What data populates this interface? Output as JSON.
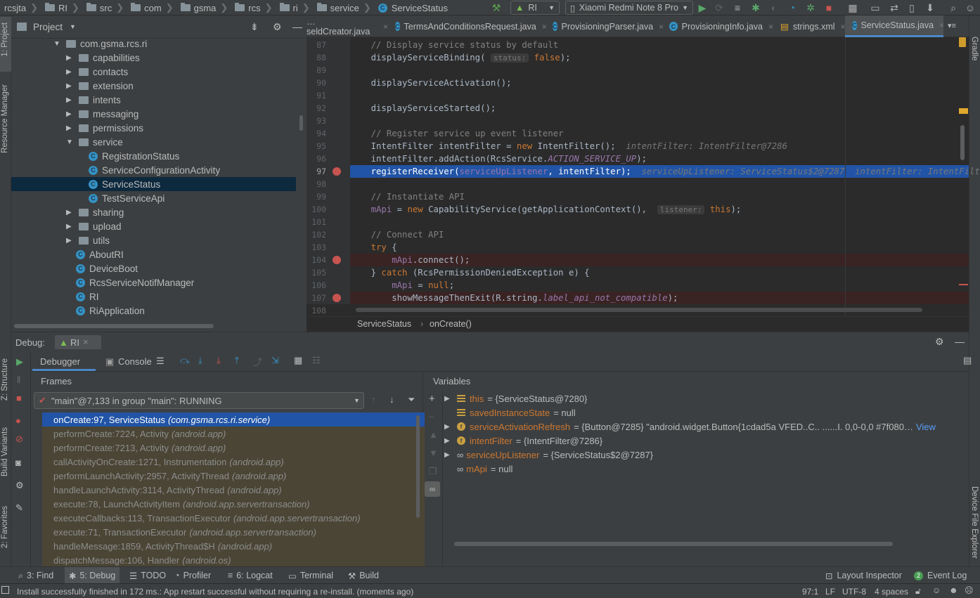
{
  "topbar": {
    "crumbs": [
      "rcsjta",
      "RI",
      "src",
      "com",
      "gsma",
      "rcs",
      "ri",
      "service",
      "ServiceStatus"
    ],
    "run_config": "RI",
    "device": "Xiaomi Redmi Note 8 Pro"
  },
  "side_left": {
    "project": "1: Project",
    "resource": "Resource Manager",
    "structure": "Z: Structure",
    "build_variants": "Build Variants",
    "favorites": "2: Favorites"
  },
  "side_right": {
    "gradle": "Gradle",
    "device_explorer": "Device File Explorer"
  },
  "project": {
    "title": "Project",
    "nodes": [
      {
        "label": "com.gsma.rcs.ri",
        "kind": "package",
        "expanded": true,
        "depth": 0
      },
      {
        "label": "capabilities",
        "kind": "folder",
        "expanded": false,
        "depth": 1
      },
      {
        "label": "contacts",
        "kind": "folder",
        "expanded": false,
        "depth": 1
      },
      {
        "label": "extension",
        "kind": "folder",
        "expanded": false,
        "depth": 1
      },
      {
        "label": "intents",
        "kind": "folder",
        "expanded": false,
        "depth": 1
      },
      {
        "label": "messaging",
        "kind": "folder",
        "expanded": false,
        "depth": 1
      },
      {
        "label": "permissions",
        "kind": "folder",
        "expanded": false,
        "depth": 1
      },
      {
        "label": "service",
        "kind": "folder",
        "expanded": true,
        "depth": 1
      },
      {
        "label": "RegistrationStatus",
        "kind": "class",
        "depth": 2
      },
      {
        "label": "ServiceConfigurationActivity",
        "kind": "class",
        "depth": 2
      },
      {
        "label": "ServiceStatus",
        "kind": "class",
        "depth": 2,
        "selected": true
      },
      {
        "label": "TestServiceApi",
        "kind": "class",
        "depth": 2
      },
      {
        "label": "sharing",
        "kind": "folder",
        "expanded": false,
        "depth": 1
      },
      {
        "label": "upload",
        "kind": "folder",
        "expanded": false,
        "depth": 1
      },
      {
        "label": "utils",
        "kind": "folder",
        "expanded": false,
        "depth": 1
      },
      {
        "label": "AboutRI",
        "kind": "class",
        "depth": 1
      },
      {
        "label": "DeviceBoot",
        "kind": "class",
        "depth": 1
      },
      {
        "label": "RcsServiceNotifManager",
        "kind": "class",
        "depth": 1
      },
      {
        "label": "RI",
        "kind": "class",
        "depth": 1
      },
      {
        "label": "RiApplication",
        "kind": "class",
        "depth": 1
      }
    ]
  },
  "editor": {
    "tabs": [
      {
        "label": "…seldCreator.java"
      },
      {
        "label": "TermsAndConditionsRequest.java"
      },
      {
        "label": "ProvisioningParser.java"
      },
      {
        "label": "ProvisioningInfo.java"
      },
      {
        "label": "strings.xml"
      },
      {
        "label": "ServiceStatus.java",
        "active": true
      }
    ],
    "lines": [
      {
        "n": "87",
        "html": "    <span class=\"cm\">// Display service status by default</span>"
      },
      {
        "n": "88",
        "html": "    displayServiceBinding( <span class=\"hint\">status:</span> <span class=\"kw\">false</span>);"
      },
      {
        "n": "89",
        "html": ""
      },
      {
        "n": "90",
        "html": "    displayServiceActivation();"
      },
      {
        "n": "91",
        "html": ""
      },
      {
        "n": "92",
        "html": "    displayServiceStarted();"
      },
      {
        "n": "93",
        "html": ""
      },
      {
        "n": "94",
        "html": "    <span class=\"cm\">// Register service up event listener</span>"
      },
      {
        "n": "95",
        "html": "    IntentFilter intentFilter = <span class=\"kw\">new</span> IntentFilter();  <span class=\"dbg\">intentFilter: IntentFilter@7286</span>"
      },
      {
        "n": "96",
        "html": "    intentFilter.addAction(RcsService.<span class=\"st\">ACTION_SERVICE_UP</span>);"
      },
      {
        "n": "97",
        "html": "    registerReceiver(<span class=\"fld\">serviceUpListener</span>, intentFilter);  <span class=\"dbg\">serviceUpListener: ServiceStatus$2@7287  intentFilter: IntentFilt</span>",
        "current": true,
        "bp": true
      },
      {
        "n": "98",
        "html": ""
      },
      {
        "n": "99",
        "html": "    <span class=\"cm\">// Instantiate API</span>"
      },
      {
        "n": "100",
        "html": "    <span class=\"fld\">mApi</span> = <span class=\"kw\">new</span> CapabilityService(getApplicationContext(),  <span class=\"hint\">listener:</span> <span class=\"kw\">this</span>);"
      },
      {
        "n": "101",
        "html": ""
      },
      {
        "n": "102",
        "html": "    <span class=\"cm\">// Connect API</span>"
      },
      {
        "n": "103",
        "html": "    <span class=\"kw\">try</span> {"
      },
      {
        "n": "104",
        "html": "        <span class=\"fld\">mApi</span>.connect();",
        "bp": true,
        "red": true
      },
      {
        "n": "105",
        "html": "    } <span class=\"kw\">catch</span> (RcsPermissionDeniedException e) {"
      },
      {
        "n": "106",
        "html": "        <span class=\"fld\">mApi</span> = <span class=\"kw\">null</span>;"
      },
      {
        "n": "107",
        "html": "        showMessageThenExit(R.string.<span class=\"st\">label_api_not_compatible</span>);",
        "bp": true,
        "red": true
      },
      {
        "n": "108",
        "html": ""
      }
    ],
    "breadcrumb": [
      "ServiceStatus",
      "onCreate()"
    ]
  },
  "debug": {
    "title": "Debug:",
    "session": "RI",
    "tabs": [
      "Debugger",
      "Console"
    ],
    "frames_title": "Frames",
    "variables_title": "Variables",
    "thread": "\"main\"@7,133 in group \"main\": RUNNING",
    "frames": [
      {
        "method": "onCreate:97, ServiceStatus",
        "pkg": "(com.gsma.rcs.ri.service)",
        "selected": true
      },
      {
        "method": "performCreate:7224, Activity",
        "pkg": "(android.app)"
      },
      {
        "method": "performCreate:7213, Activity",
        "pkg": "(android.app)"
      },
      {
        "method": "callActivityOnCreate:1271, Instrumentation",
        "pkg": "(android.app)"
      },
      {
        "method": "performLaunchActivity:2957, ActivityThread",
        "pkg": "(android.app)"
      },
      {
        "method": "handleLaunchActivity:3114, ActivityThread",
        "pkg": "(android.app)"
      },
      {
        "method": "execute:78, LaunchActivityItem",
        "pkg": "(android.app.servertransaction)"
      },
      {
        "method": "executeCallbacks:113, TransactionExecutor",
        "pkg": "(android.app.servertransaction)"
      },
      {
        "method": "execute:71, TransactionExecutor",
        "pkg": "(android.app.servertransaction)"
      },
      {
        "method": "handleMessage:1859, ActivityThread$H",
        "pkg": "(android.app)"
      },
      {
        "method": "dispatchMessage:106, Handler",
        "pkg": "(android.os)"
      }
    ],
    "variables": [
      {
        "name": "this",
        "value": "= {ServiceStatus@7280}",
        "icon": "lines",
        "expand": true
      },
      {
        "name": "savedInstanceState",
        "value": "= null",
        "icon": "lines"
      },
      {
        "name": "serviceActivationRefresh",
        "value": "= {Button@7285} \"android.widget.Button{1cdad5a VFED..C.. ......I. 0,0-0,0 #7f080…",
        "icon": "field",
        "expand": true,
        "view": "View"
      },
      {
        "name": "intentFilter",
        "value": "= {IntentFilter@7286}",
        "icon": "field",
        "expand": true
      },
      {
        "name": "serviceUpListener",
        "value": "= {ServiceStatus$2@7287}",
        "icon": "watch",
        "expand": true
      },
      {
        "name": "mApi",
        "value": "= null",
        "icon": "watch"
      }
    ]
  },
  "bottom_tabs": [
    {
      "label": "3: Find"
    },
    {
      "label": "5: Debug",
      "active": true
    },
    {
      "label": "TODO"
    },
    {
      "label": "Profiler"
    },
    {
      "label": "6: Logcat"
    },
    {
      "label": "Terminal"
    },
    {
      "label": "Build"
    }
  ],
  "bottom_right": {
    "layout": "Layout Inspector",
    "event_log": "Event Log",
    "event_count": "2"
  },
  "status": {
    "message": "Install successfully finished in 172 ms.: App restart successful without requiring a re-install. (moments ago)",
    "position": "97:1",
    "line_sep": "LF",
    "encoding": "UTF-8",
    "indent": "4 spaces"
  }
}
